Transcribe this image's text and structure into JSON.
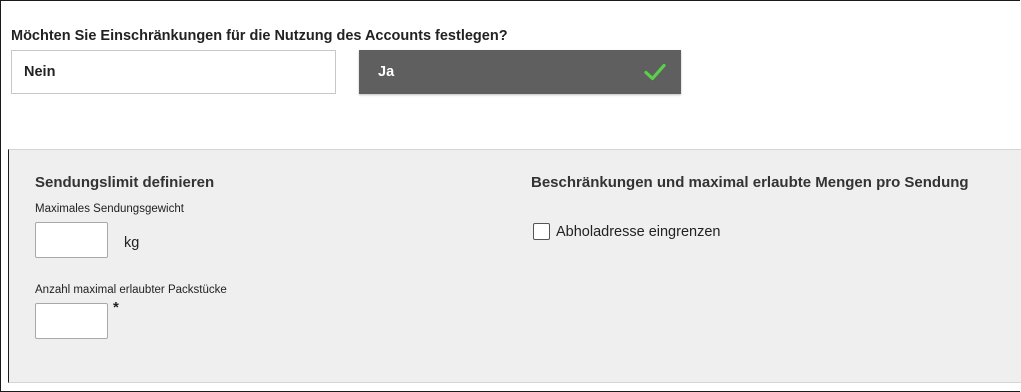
{
  "question": {
    "text": "Möchten Sie Einschränkungen für die Nutzung des Accounts festlegen?"
  },
  "choices": {
    "no_label": "Nein",
    "yes_label": "Ja",
    "selected": "Ja",
    "selected_icon": "check-icon",
    "selected_icon_color": "#5ad04a"
  },
  "shipment_limit": {
    "title": "Sendungslimit definieren",
    "max_weight_label": "Maximales Sendungsgewicht",
    "max_weight_value": "",
    "weight_unit": "kg",
    "max_pieces_label": "Anzahl maximal erlaubter Packstücke",
    "max_pieces_value": "",
    "required_marker": "*"
  },
  "restrictions": {
    "title": "Beschränkungen und maximal erlaubte Mengen pro Sendung",
    "pickup_checkbox_label": "Abholadresse eingrenzen",
    "pickup_checked": false
  },
  "colors": {
    "selected_button_bg": "#5f5f5f",
    "panel_bg": "#efefef"
  }
}
